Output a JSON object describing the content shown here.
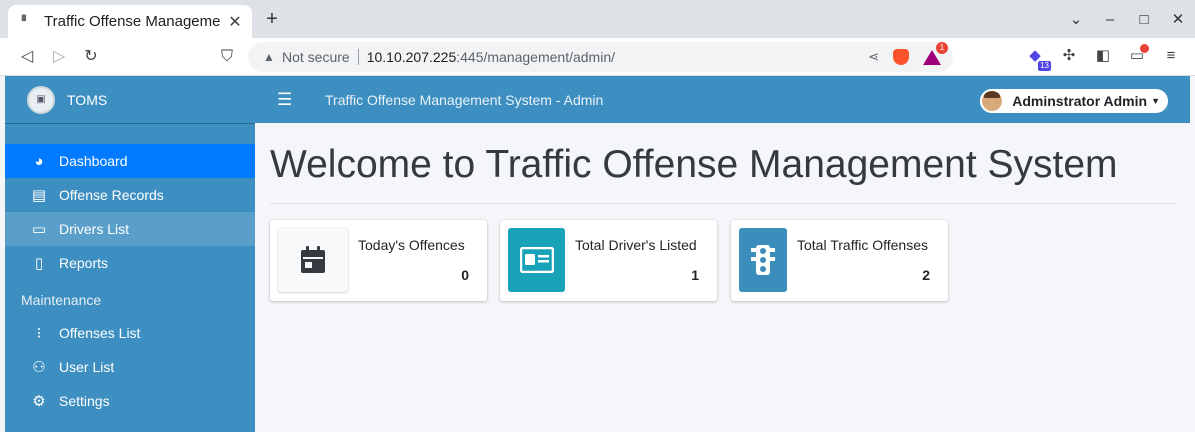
{
  "browser": {
    "tab_title": "Traffic Offense Manageme",
    "tab_close": "✕",
    "new_tab": "+",
    "window_controls": [
      "⌄",
      "–",
      "□",
      "✕"
    ],
    "nav": {
      "back": "◁",
      "forward": "▷",
      "reload": "↻",
      "bookmark": "⛉"
    },
    "security_label": "Not secure",
    "url_host": "10.10.207.225",
    "url_rest": ":445/management/admin/",
    "bat_badge": "1",
    "ext_badge": "13"
  },
  "sidebar": {
    "brand": "TOMS",
    "items": [
      {
        "label": "Dashboard",
        "icon": "tachometer-icon",
        "glyph": "◕"
      },
      {
        "label": "Offense Records",
        "icon": "file-icon",
        "glyph": "▤"
      },
      {
        "label": "Drivers List",
        "icon": "id-card-icon",
        "glyph": "▭"
      },
      {
        "label": "Reports",
        "icon": "file-icon",
        "glyph": "▯"
      }
    ],
    "section_header": "Maintenance",
    "maintenance_items": [
      {
        "label": "Offenses List",
        "icon": "traffic-light-icon",
        "glyph": "⁝"
      },
      {
        "label": "User List",
        "icon": "users-icon",
        "glyph": "⚇"
      },
      {
        "label": "Settings",
        "icon": "cogs-icon",
        "glyph": "⚙"
      }
    ]
  },
  "topbar": {
    "title": "Traffic Offense Management System - Admin",
    "user": "Adminstrator Admin"
  },
  "main": {
    "heading": "Welcome to Traffic Offense Management System",
    "cards": [
      {
        "label": "Today's Offences",
        "value": "0",
        "icon": "calendar-icon",
        "color": "#f8f9fa"
      },
      {
        "label": "Total Driver's Listed",
        "value": "1",
        "icon": "id-card-icon",
        "color": "#17a2b8"
      },
      {
        "label": "Total Traffic Offenses",
        "value": "2",
        "icon": "traffic-light-icon",
        "color": "#3c8dbc"
      }
    ]
  }
}
